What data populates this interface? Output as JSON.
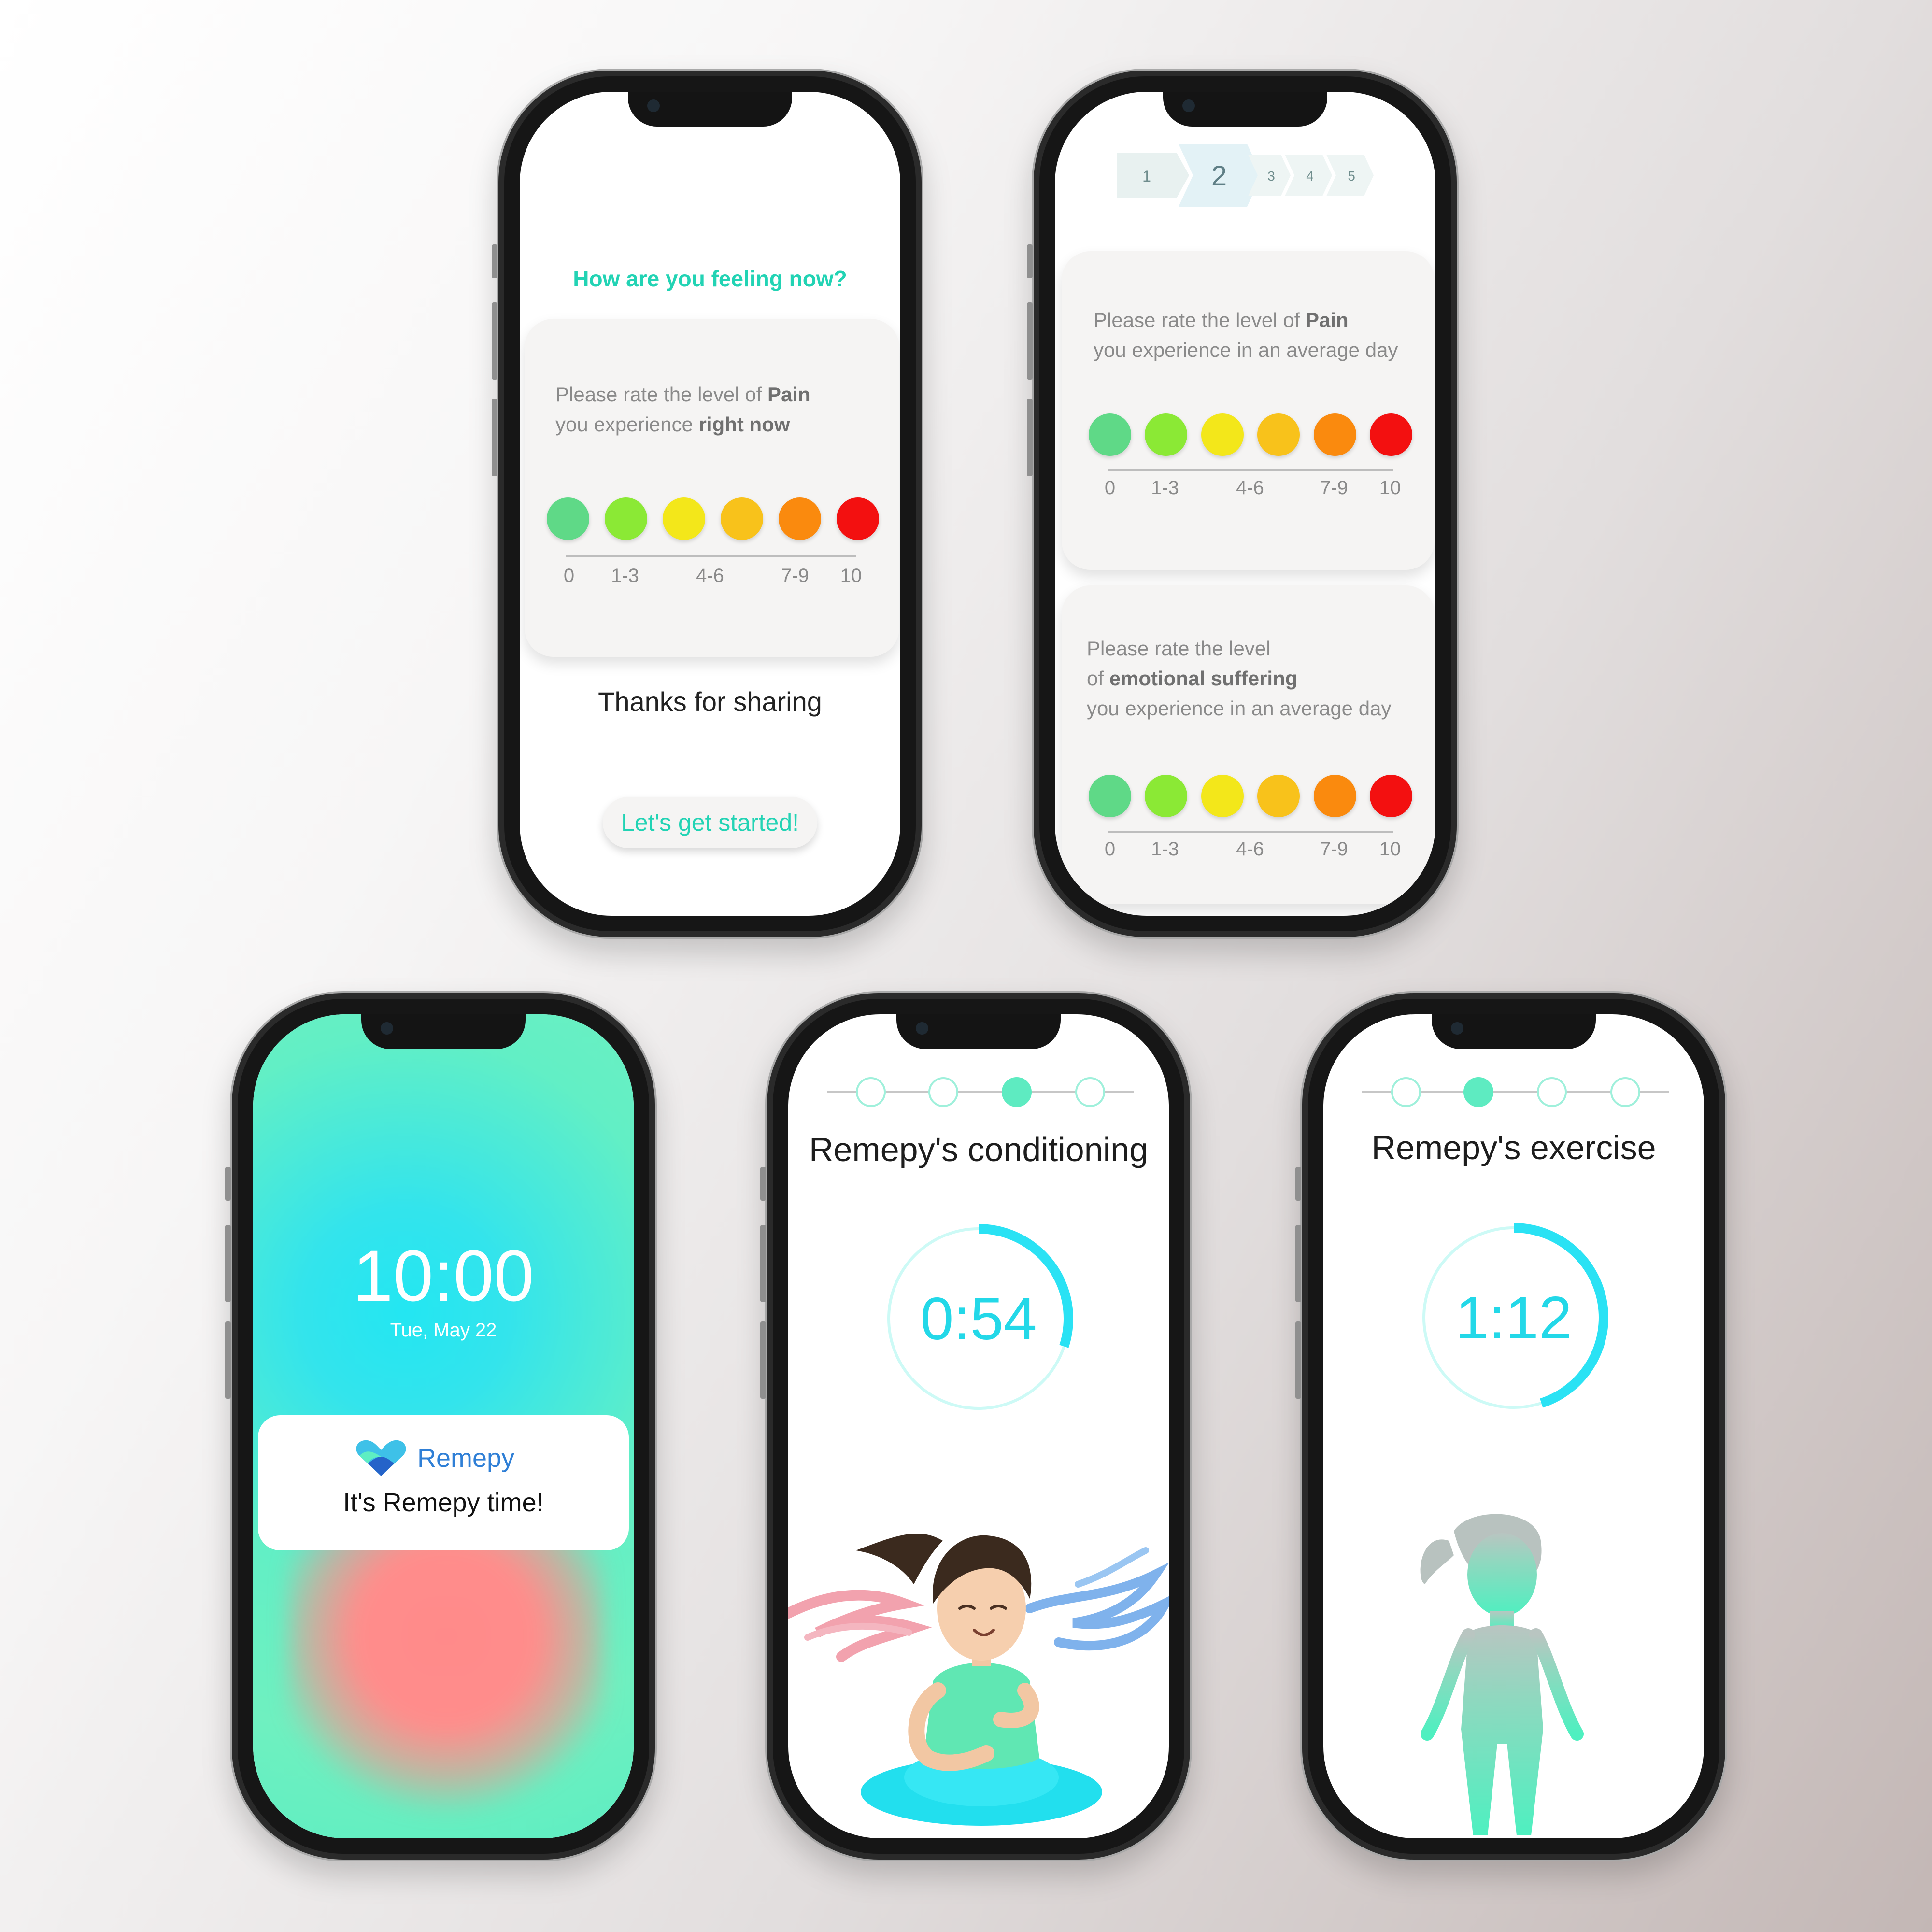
{
  "colors": {
    "accent": "#22d3b4",
    "timer": "#23d8e8",
    "scale": [
      "#5fd987",
      "#8be935",
      "#f3e71a",
      "#f8c21b",
      "#fa8a0e",
      "#f31010"
    ]
  },
  "scale_labels": [
    "0",
    "1-3",
    "4-6",
    "7-9",
    "10"
  ],
  "screen_feeling": {
    "title": "How are you feeling now?",
    "prompt_prefix": "Please rate the level of",
    "prompt_bold": "Pain",
    "prompt_line2_prefix": "you experience",
    "prompt_line2_bold": "right now",
    "thanks": "Thanks for sharing",
    "cta": "Let's get started!"
  },
  "screen_rating": {
    "steps": [
      "1",
      "2",
      "3",
      "4",
      "5"
    ],
    "active_step": "2",
    "card1": {
      "prefix": "Please rate the level of",
      "bold": "Pain",
      "line2": "you experience in an average day"
    },
    "card2": {
      "line1": "Please rate the level",
      "line2_prefix": "of",
      "line2_bold": "emotional suffering",
      "line3": "you experience in an average day"
    }
  },
  "screen_lock": {
    "time": "10:00",
    "date": "Tue, May 22",
    "app_name": "Remepy",
    "message": "It's Remepy time!",
    "app_icon": "heart-logo-icon"
  },
  "screen_conditioning": {
    "title": "Remepy's conditioning",
    "timer": "0:54",
    "progress_fraction": 0.3,
    "active_dot": 3
  },
  "screen_exercise": {
    "title": "Remepy's exercise",
    "timer": "1:12",
    "progress_fraction": 0.45,
    "active_dot": 2
  }
}
